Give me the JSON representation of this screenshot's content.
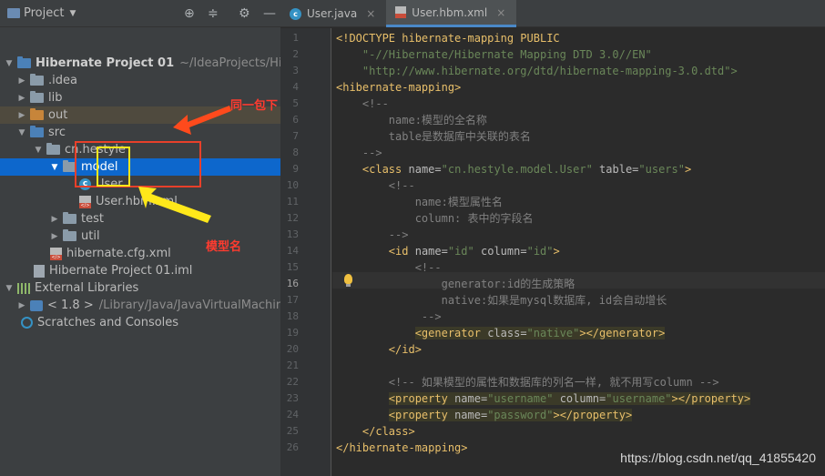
{
  "project_panel": {
    "title": "Project",
    "tree": [
      {
        "label": "Hibernate Project 01",
        "detail": "~/IdeaProjects/Hibernate",
        "icon": "project-folder-icon"
      },
      {
        "label": ".idea",
        "icon": "folder-icon"
      },
      {
        "label": "lib",
        "icon": "folder-icon"
      },
      {
        "label": "out",
        "icon": "folder-orange-icon"
      },
      {
        "label": "src",
        "icon": "source-folder-icon"
      },
      {
        "label": "cn.hestyle",
        "icon": "package-icon"
      },
      {
        "label": "model",
        "icon": "package-icon"
      },
      {
        "label": "User",
        "icon": "java-class-icon"
      },
      {
        "label": "User.hbm.xml",
        "icon": "xml-file-icon"
      },
      {
        "label": "test",
        "icon": "package-icon"
      },
      {
        "label": "util",
        "icon": "package-icon"
      },
      {
        "label": "hibernate.cfg.xml",
        "icon": "xml-file-icon"
      },
      {
        "label": "Hibernate Project 01.iml",
        "icon": "iml-file-icon"
      },
      {
        "label": "External Libraries",
        "icon": "library-icon"
      },
      {
        "label": "< 1.8 >",
        "detail": "/Library/Java/JavaVirtualMachine",
        "icon": "jdk-icon"
      },
      {
        "label": "Scratches and Consoles",
        "icon": "scratches-icon"
      }
    ]
  },
  "annotations": {
    "same_package": "同一包下",
    "model_name": "模型名"
  },
  "editor": {
    "tabs": [
      {
        "label": "User.java",
        "icon": "java-class-icon",
        "active": false
      },
      {
        "label": "User.hbm.xml",
        "icon": "xml-file-icon",
        "active": true
      }
    ],
    "current_line": 16,
    "lines": [
      {
        "n": "1",
        "text": "<!DOCTYPE hibernate-mapping PUBLIC"
      },
      {
        "n": "2",
        "text": "    \"-//Hibernate/Hibernate Mapping DTD 3.0//EN\""
      },
      {
        "n": "3",
        "text": "    \"http://www.hibernate.org/dtd/hibernate-mapping-3.0.dtd\">"
      },
      {
        "n": "4",
        "text": "<hibernate-mapping>"
      },
      {
        "n": "5",
        "text": "    <!--"
      },
      {
        "n": "6",
        "text": "        name:模型的全名称"
      },
      {
        "n": "7",
        "text": "        table是数据库中关联的表名"
      },
      {
        "n": "8",
        "text": "    -->"
      },
      {
        "n": "9",
        "text": "    <class name=\"cn.hestyle.model.User\" table=\"users\">"
      },
      {
        "n": "10",
        "text": "        <!--"
      },
      {
        "n": "11",
        "text": "            name:模型属性名"
      },
      {
        "n": "12",
        "text": "            column: 表中的字段名"
      },
      {
        "n": "13",
        "text": "        -->"
      },
      {
        "n": "14",
        "text": "        <id name=\"id\" column=\"id\">"
      },
      {
        "n": "15",
        "text": "            <!--"
      },
      {
        "n": "16",
        "text": "                generator:id的生成策略"
      },
      {
        "n": "17",
        "text": "                native:如果是mysql数据库, id会自动增长"
      },
      {
        "n": "18",
        "text": "             -->"
      },
      {
        "n": "19",
        "text": "            <generator class=\"native\"></generator>"
      },
      {
        "n": "20",
        "text": "        </id>"
      },
      {
        "n": "21",
        "text": ""
      },
      {
        "n": "22",
        "text": "        <!-- 如果模型的属性和数据库的列名一样, 就不用写column -->"
      },
      {
        "n": "23",
        "text": "        <property name=\"username\" column=\"username\"></property>"
      },
      {
        "n": "24",
        "text": "        <property name=\"password\"></property>"
      },
      {
        "n": "25",
        "text": "    </class>"
      },
      {
        "n": "26",
        "text": "</hibernate-mapping>"
      }
    ]
  },
  "watermark": "https://blog.csdn.net/qq_41855420"
}
